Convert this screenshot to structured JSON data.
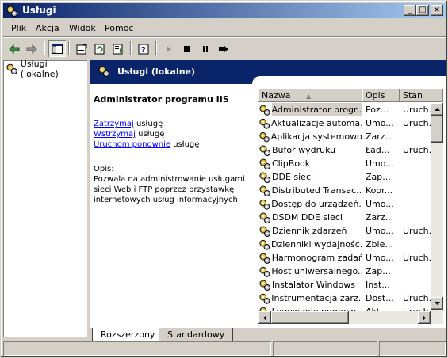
{
  "window": {
    "title": "Usługi",
    "minimize": "_",
    "maximize": "□",
    "close": "×"
  },
  "menu": [
    "Plik",
    "Akcja",
    "Widok",
    "Pomoc"
  ],
  "menu_hotkeys": [
    "P",
    "A",
    "W",
    "m"
  ],
  "tree": {
    "root": "Usługi (lokalne)"
  },
  "panel": {
    "header": "Usługi (lokalne)",
    "service_title": "Administrator programu IIS",
    "actions": [
      {
        "link": "Zatrzymaj",
        "rest": " usługę"
      },
      {
        "link": "Wstrzymaj",
        "rest": " usługę"
      },
      {
        "link": "Uruchom ponownie",
        "rest": " usługę"
      }
    ],
    "desc_label": "Opis:",
    "desc_text": "Pozwala na administrowanie usługami sieci Web i FTP poprzez przystawkę internetowych usług informacyjnych"
  },
  "columns": [
    "Nazwa",
    "Opis",
    "Stan"
  ],
  "sort_indicator": "▲",
  "rows": [
    {
      "name": "Administrator progr...",
      "desc": "Poz...",
      "state": "Uruch..."
    },
    {
      "name": "Aktualizacje automa...",
      "desc": "Umo...",
      "state": "Uruch..."
    },
    {
      "name": "Aplikacja systemowo...",
      "desc": "Zarz...",
      "state": ""
    },
    {
      "name": "Bufor wydruku",
      "desc": "Ład...",
      "state": "Uruch..."
    },
    {
      "name": "ClipBook",
      "desc": "Umo...",
      "state": ""
    },
    {
      "name": "DDE sieci",
      "desc": "Zap...",
      "state": ""
    },
    {
      "name": "Distributed Transac...",
      "desc": "Koor...",
      "state": ""
    },
    {
      "name": "Dostęp do urządzeń...",
      "desc": "Umo...",
      "state": ""
    },
    {
      "name": "DSDM DDE sieci",
      "desc": "Zarz...",
      "state": ""
    },
    {
      "name": "Dziennik zdarzeń",
      "desc": "Umo...",
      "state": "Uruch..."
    },
    {
      "name": "Dzienniki wydajnośc...",
      "desc": "Zbie...",
      "state": ""
    },
    {
      "name": "Harmonogram zadań",
      "desc": "Umo...",
      "state": "Uruch..."
    },
    {
      "name": "Host uniwersalnego...",
      "desc": "Zap...",
      "state": ""
    },
    {
      "name": "Instalator Windows",
      "desc": "Inst...",
      "state": ""
    },
    {
      "name": "Instrumentacja zarz...",
      "desc": "Dost...",
      "state": "Uruch..."
    },
    {
      "name": "Logowanie pomocn...",
      "desc": "Akt...",
      "state": "Uruch..."
    }
  ],
  "tabs": [
    "Rozszerzony",
    "Standardowy"
  ]
}
